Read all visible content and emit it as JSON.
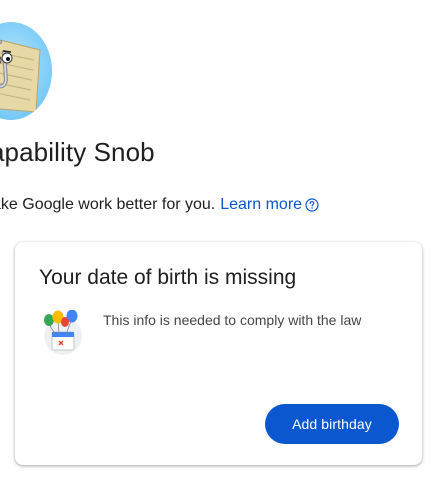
{
  "profile": {
    "name": "apability Snob",
    "avatar_icon": "clippy-avatar-icon"
  },
  "subtitle": {
    "text": "ake Google work better for you.",
    "learn_more_label": "Learn more",
    "help_icon": "help-circle-icon"
  },
  "card": {
    "title": "Your date of birth is missing",
    "body": "This info is needed to comply with the law",
    "illustration_icon": "birthday-balloons-icon",
    "button_label": "Add birthday"
  },
  "colors": {
    "accent": "#0b57d0",
    "text": "#1f1f1f",
    "secondary_text": "#444746"
  }
}
